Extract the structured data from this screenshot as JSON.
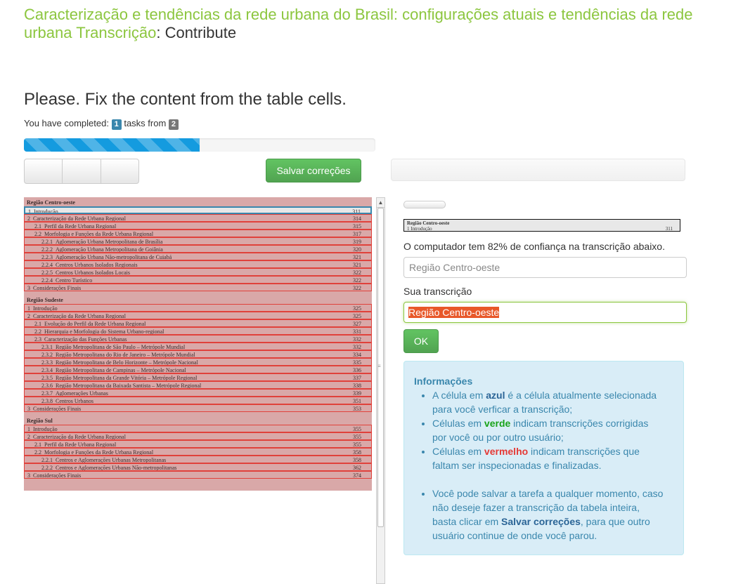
{
  "header": {
    "title": "Caracterização e tendências da rede urbana do Brasil: configurações atuais e tendências da rede urbana Transcrição",
    "separator": ":",
    "contribute": "Contribute"
  },
  "task": {
    "instruction": "Please. Fix the content from the table cells.",
    "completed_prefix": "You have completed:",
    "completed_count": "1",
    "tasks_from": "tasks from",
    "total_count": "2",
    "progress_fraction": 0.5
  },
  "toolbar": {
    "save_label": "Salvar correções"
  },
  "document": {
    "sections": [
      {
        "heading": "Região Centro-oeste",
        "rows": [
          {
            "num": "1",
            "text": "Introdução",
            "page": "311",
            "indent": 0,
            "selected": true
          },
          {
            "num": "2",
            "text": "Caracterização da Rede Urbana Regional",
            "page": "314",
            "indent": 0
          },
          {
            "num": "2.1",
            "text": "Perfil da Rede Urbana Regional",
            "page": "315",
            "indent": 1
          },
          {
            "num": "2.2",
            "text": "Morfologia e Funções da Rede Urbana Regional",
            "page": "317",
            "indent": 1
          },
          {
            "num": "2.2.1",
            "text": "Aglomeração Urbana Metropolitana de Brasília",
            "page": "319",
            "indent": 2
          },
          {
            "num": "2.2.2",
            "text": "Aglomeração Urbana Metropolitana de Goiânia",
            "page": "320",
            "indent": 2
          },
          {
            "num": "2.2.3",
            "text": "Aglomeração Urbana Não-metropolitana de Cuiabá",
            "page": "321",
            "indent": 2
          },
          {
            "num": "2.2.4",
            "text": "Centros Urbanos Isolados Regionais",
            "page": "321",
            "indent": 2
          },
          {
            "num": "2.2.5",
            "text": "Centros Urbanos Isolados Locais",
            "page": "322",
            "indent": 2
          },
          {
            "num": "2.2.4",
            "text": "Centro Turístico",
            "page": "322",
            "indent": 2
          },
          {
            "num": "3",
            "text": "Considerações Finais",
            "page": "322",
            "indent": 0
          }
        ]
      },
      {
        "heading": "Região Sudeste",
        "rows": [
          {
            "num": "1",
            "text": "Introdução",
            "page": "325",
            "indent": 0
          },
          {
            "num": "2",
            "text": "Caracterização da Rede Urbana Regional",
            "page": "325",
            "indent": 0
          },
          {
            "num": "2.1",
            "text": "Evolução do Perfil da Rede Urbana Regional",
            "page": "327",
            "indent": 1
          },
          {
            "num": "2.2",
            "text": "Hierarquia e Morfologia do Sistema Urbano-regional",
            "page": "331",
            "indent": 1
          },
          {
            "num": "2.3",
            "text": "Caracterização das Funções Urbanas",
            "page": "332",
            "indent": 1
          },
          {
            "num": "2.3.1",
            "text": "Região Metropolitana de São Paulo – Metrópole Mundial",
            "page": "332",
            "indent": 2
          },
          {
            "num": "2.3.2",
            "text": "Região Metropolitana do Rio de Janeiro – Metrópole Mundial",
            "page": "334",
            "indent": 2
          },
          {
            "num": "2.3.3",
            "text": "Região Metropolitana de Belo Horizonte – Metrópole Nacional",
            "page": "335",
            "indent": 2
          },
          {
            "num": "2.3.4",
            "text": "Região Metropolitana de Campinas – Metrópole Nacional",
            "page": "336",
            "indent": 2
          },
          {
            "num": "2.3.5",
            "text": "Região Metropolitana da Grande Vitória – Metrópole Regional",
            "page": "337",
            "indent": 2
          },
          {
            "num": "2.3.6",
            "text": "Região Metropolitana da Baixada Santista – Metrópole Regional",
            "page": "338",
            "indent": 2
          },
          {
            "num": "2.3.7",
            "text": "Aglomerações Urbanas",
            "page": "339",
            "indent": 2
          },
          {
            "num": "2.3.8",
            "text": "Centros Urbanos",
            "page": "351",
            "indent": 2
          },
          {
            "num": "3",
            "text": "Considerações Finais",
            "page": "353",
            "indent": 0
          }
        ]
      },
      {
        "heading": "Região Sul",
        "rows": [
          {
            "num": "1",
            "text": "Introdução",
            "page": "355",
            "indent": 0
          },
          {
            "num": "2",
            "text": "Caracterização da Rede Urbana Regional",
            "page": "355",
            "indent": 0
          },
          {
            "num": "2.1",
            "text": "Perfil da Rede Urbana Regional",
            "page": "355",
            "indent": 1
          },
          {
            "num": "2.2",
            "text": "Morfologia e Funções da Rede Urbana Regional",
            "page": "358",
            "indent": 1
          },
          {
            "num": "2.2.1",
            "text": "Centros e Aglomerações Urbanas Metropolitanas",
            "page": "358",
            "indent": 2
          },
          {
            "num": "2.2.2",
            "text": "Centros e Aglomerações Urbanas Não-metropolitanas",
            "page": "362",
            "indent": 2
          },
          {
            "num": "3",
            "text": "Considerações Finais",
            "page": "374",
            "indent": 0
          }
        ]
      }
    ]
  },
  "preview": {
    "line1": "Região Centro-oeste",
    "line2": "1   Introdução",
    "page": "311"
  },
  "transcription": {
    "confidence_text": "O computador tem 82% de confiança na transcrição abaixo.",
    "computer_value": "Região Centro-oeste",
    "your_label": "Sua transcrição",
    "your_value": "Região Centro-oeste",
    "ok_label": "OK"
  },
  "info": {
    "title": "Informações",
    "b1_pre": "A célula em ",
    "b1_key": "azul",
    "b1_post": " é a célula atualmente selecionada para você verficar a transcrição;",
    "b2_pre": "Células em ",
    "b2_key": "verde",
    "b2_post": " indicam transcrições corrigidas por você ou por outro usuário;",
    "b3_pre": "Células em ",
    "b3_key": "vermelho",
    "b3_post": " indicam transcrições que faltam ser inspecionadas e finalizadas.",
    "b4_pre": "Você pode salvar a tarefa a qualquer momento, caso não deseje fazer a transcrição da tabela inteira, basta clicar em ",
    "b4_key": "Salvar correções",
    "b4_post": ", para que outro usuário continue de onde você parou."
  },
  "colors": {
    "title_green": "#8cc63f",
    "selected_blue": "#3a87ad",
    "pending_red": "#e0413b",
    "success_green": "#51a351"
  }
}
